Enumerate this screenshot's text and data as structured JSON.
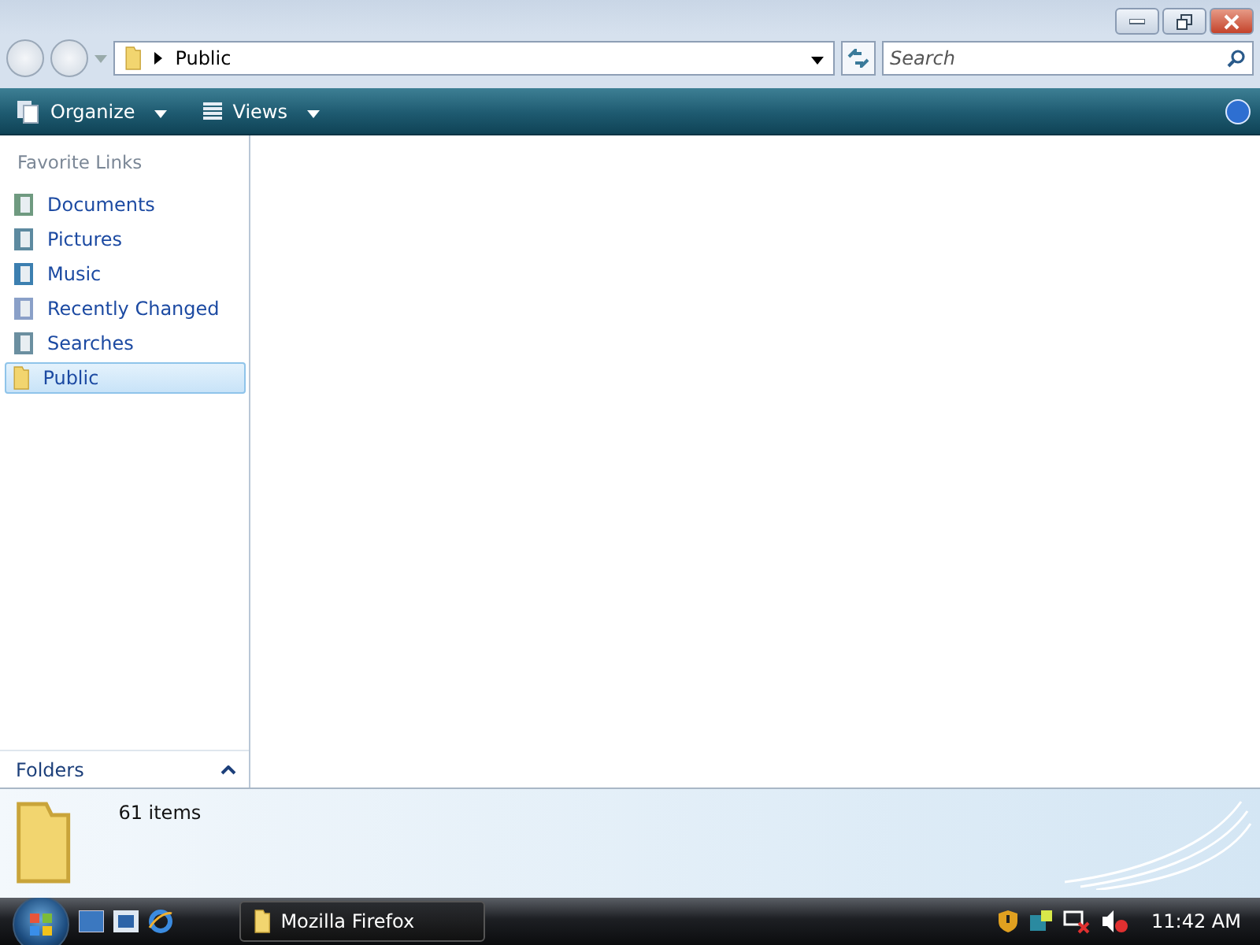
{
  "address": {
    "path": "Public"
  },
  "search": {
    "placeholder": "Search"
  },
  "toolbar": {
    "buttons": [
      {
        "label": "Organize",
        "kind": "organize"
      },
      {
        "label": "Views",
        "kind": "views"
      }
    ]
  },
  "sidebar": {
    "heading": "Favorite Links",
    "items": [
      {
        "label": "Documents",
        "kind": "documents",
        "selected": false
      },
      {
        "label": "Pictures",
        "kind": "pictures",
        "selected": false
      },
      {
        "label": "Music",
        "kind": "music",
        "selected": false
      },
      {
        "label": "Recently Changed",
        "kind": "recent",
        "selected": false
      },
      {
        "label": "Searches",
        "kind": "searches",
        "selected": false
      },
      {
        "label": "Public",
        "kind": "folder",
        "selected": true
      }
    ],
    "folders": {
      "label": "Folders",
      "expanded": true
    }
  },
  "details": {
    "count": "61 items"
  },
  "taskbar": {
    "tasks": [
      {
        "label": "Mozilla Firefox"
      }
    ],
    "clock": "11:42 AM"
  }
}
